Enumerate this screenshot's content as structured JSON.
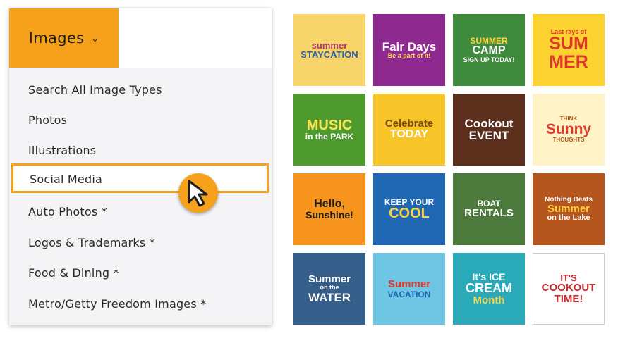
{
  "dropdown": {
    "label": "Images",
    "chevron_icon": "chevron-down-icon",
    "accent_color": "#f5a11c"
  },
  "menu": {
    "items": [
      {
        "label": "Search All Image Types"
      },
      {
        "label": "Photos"
      },
      {
        "label": "Illustrations"
      },
      {
        "label": "Social Media",
        "selected": true
      },
      {
        "label": "Auto Photos *"
      },
      {
        "label": "Logos & Trademarks *"
      },
      {
        "label": "Food & Dining *"
      },
      {
        "label": "Metro/Getty Freedom Images *"
      }
    ],
    "cursor_icon": "pointer-cursor-icon"
  },
  "tiles": [
    {
      "l1": "summer",
      "l2": "STAYCATION",
      "l3": "",
      "bg": "#f7d46a"
    },
    {
      "l1": "Fair Days",
      "l2": "Be a part of it!",
      "l3": "",
      "bg": "#8e2a8f"
    },
    {
      "l1": "SUMMER",
      "l2": "CAMP",
      "l3": "SIGN UP TODAY!",
      "bg": "#3f8a3c"
    },
    {
      "l1": "Last rays of",
      "l2": "SUM",
      "l3": "MER",
      "bg": "#fbd230"
    },
    {
      "l1": "MUSIC",
      "l2": "in the PARK",
      "l3": "",
      "bg": "#4f9a2f"
    },
    {
      "l1": "Celebrate",
      "l2": "TODAY",
      "l3": "",
      "bg": "#f7c52a"
    },
    {
      "l1": "Cookout",
      "l2": "EVENT",
      "l3": "",
      "bg": "#5b2f1c"
    },
    {
      "l1": "THINK",
      "l2": "Sunny",
      "l3": "THOUGHTS",
      "bg": "#fff4c8"
    },
    {
      "l1": "Hello,",
      "l2": "Sunshine!",
      "l3": "",
      "bg": "#f7941d"
    },
    {
      "l1": "KEEP YOUR",
      "l2": "COOL",
      "l3": "",
      "bg": "#1f67b3"
    },
    {
      "l1": "BOAT",
      "l2": "RENTALS",
      "l3": "",
      "bg": "#4b7a3c"
    },
    {
      "l1": "Nothing Beats",
      "l2": "Summer",
      "l3": "on the Lake",
      "bg": "#b5561f"
    },
    {
      "l1": "Summer",
      "l2": "on the",
      "l3": "WATER",
      "bg": "#355e8a"
    },
    {
      "l1": "Summer",
      "l2": "VACATION",
      "l3": "",
      "bg": "#6fc6e4"
    },
    {
      "l1": "It's ICE",
      "l2": "CREAM",
      "l3": "Month",
      "bg": "#2aa9b8"
    },
    {
      "l1": "IT'S",
      "l2": "COOKOUT",
      "l3": "TIME!",
      "bg": "#ffffff"
    }
  ]
}
